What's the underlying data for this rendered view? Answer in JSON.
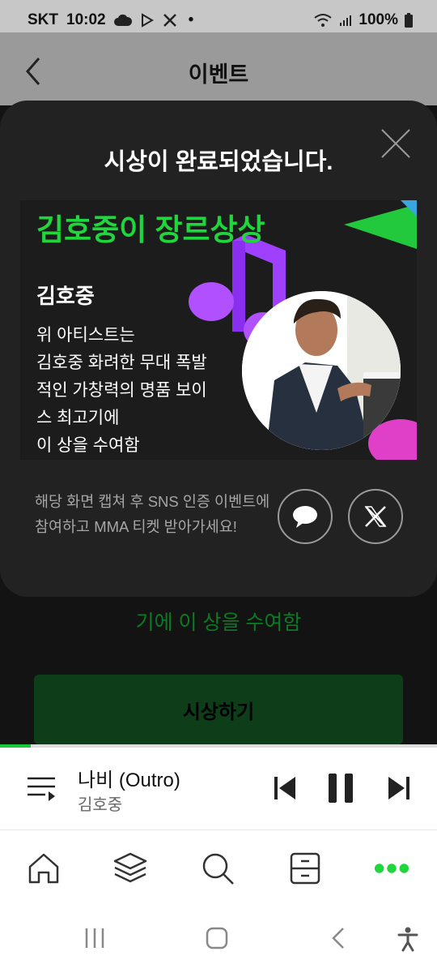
{
  "status_bar": {
    "carrier": "SKT",
    "time": "10:02",
    "dot": "•",
    "battery": "100%"
  },
  "header": {
    "title": "이벤트"
  },
  "background": {
    "partial_text": "기에 이 상을 수여함",
    "award_button_label": "시상하기",
    "progress_fraction": 0.07
  },
  "modal": {
    "title": "시상이 완료되었습니다.",
    "card": {
      "award_title": "김호중이 장르상상",
      "artist_name": "김호중",
      "lines": [
        "위 아티스트는",
        "김호중 화려한 무대 폭발",
        "적인 가창력의 명품 보이",
        "스 최고기에",
        "이 상을 수여함"
      ]
    },
    "share_text_line1": "해당 화면 캡쳐 후 SNS 인증 이벤트에",
    "share_text_line2": "참여하고 MMA 티켓 받아가세요!"
  },
  "player": {
    "track_title": "나비 (Outro)",
    "artist": "김호중"
  },
  "bottom_nav": {
    "items": [
      "home-icon",
      "library-icon",
      "search-icon",
      "storage-icon",
      "more-icon"
    ],
    "active": "more-icon"
  },
  "colors": {
    "accent": "#1fd63c",
    "modal_bg": "#222222"
  }
}
